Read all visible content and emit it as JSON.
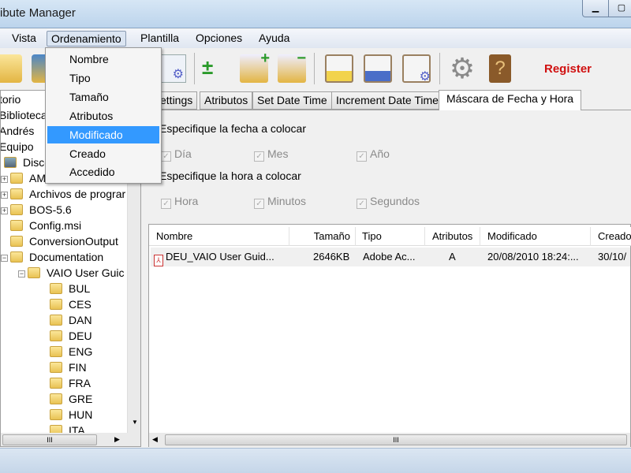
{
  "window": {
    "title": "ibute Manager"
  },
  "menubar": {
    "items": [
      "Vista",
      "Ordenamiento",
      "Plantilla",
      "Opciones",
      "Ayuda"
    ],
    "open": "Ordenamiento"
  },
  "dropdown": {
    "items": [
      "Nombre",
      "Tipo",
      "Tamaño",
      "Atributos",
      "Modificado",
      "Creado",
      "Accedido"
    ],
    "highlighted": "Modificado"
  },
  "toolbar": {
    "register_label": "Register",
    "register_color": "#d01010"
  },
  "tree": {
    "items": [
      "torio",
      "Bibliotecas",
      "Andrés",
      "Equipo",
      "Disco",
      "AM",
      "Archivos de prograr",
      "BOS-5.6",
      "Config.msi",
      "ConversionOutput",
      "Documentation",
      "VAIO User Guic",
      "BUL",
      "CES",
      "DAN",
      "DEU",
      "ENG",
      "FIN",
      "FRA",
      "GRE",
      "HUN",
      "ITA"
    ]
  },
  "tabs": {
    "items": [
      "ettings",
      "Atributos",
      "Set Date Time",
      "Increment Date Time",
      "Máscara de Fecha y Hora"
    ],
    "selected": "Máscara de Fecha y Hora"
  },
  "mask": {
    "date_label": "Especifique la fecha a colocar",
    "date_checks": [
      "Día",
      "Mes",
      "Año"
    ],
    "time_label": "Especifique la hora a colocar",
    "time_checks": [
      "Hora",
      "Minutos",
      "Segundos"
    ]
  },
  "list": {
    "columns": [
      "Nombre",
      "Tamaño",
      "Tipo",
      "Atributos",
      "Modificado",
      "Creado"
    ],
    "rows": [
      {
        "name": "DEU_VAIO User Guid...",
        "size": "2646KB",
        "type": "Adobe Ac...",
        "attr": "A",
        "modified": "20/08/2010 18:24:...",
        "created": "30/10/"
      }
    ]
  },
  "scroll": {
    "grip": "III"
  }
}
